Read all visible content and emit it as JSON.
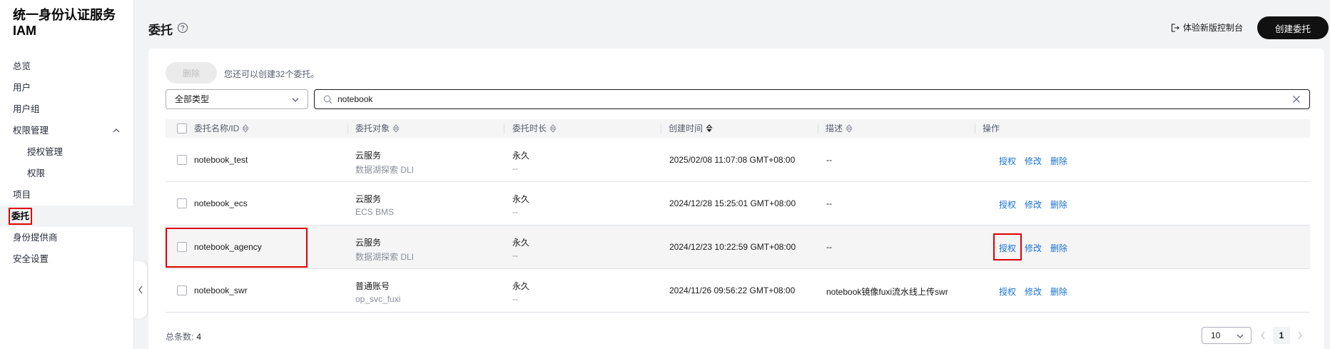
{
  "app": {
    "title": "统一身份认证服务 IAM"
  },
  "sidebar": {
    "items": [
      {
        "label": "总览"
      },
      {
        "label": "用户"
      },
      {
        "label": "用户组"
      },
      {
        "label": "权限管理"
      },
      {
        "label": "授权管理"
      },
      {
        "label": "权限"
      },
      {
        "label": "项目"
      },
      {
        "label": "委托"
      },
      {
        "label": "身份提供商"
      },
      {
        "label": "安全设置"
      }
    ]
  },
  "header": {
    "title": "委托",
    "console_link": "体验新版控制台",
    "create_button": "创建委托"
  },
  "toolbar": {
    "delete_button": "删除",
    "quota_text": "您还可以创建32个委托。",
    "type_filter": "全部类型",
    "search_value": "notebook"
  },
  "table": {
    "columns": [
      "委托名称/ID",
      "委托对象",
      "委托时长",
      "创建时间",
      "描述",
      "操作"
    ],
    "rows": [
      {
        "name": "notebook_test",
        "target": "云服务",
        "target_sub": "数据湖探索 DLI",
        "duration": "永久",
        "duration_sub": "--",
        "created": "2025/02/08 11:07:08 GMT+08:00",
        "desc": "--"
      },
      {
        "name": "notebook_ecs",
        "target": "云服务",
        "target_sub": "ECS BMS",
        "duration": "永久",
        "duration_sub": "--",
        "created": "2024/12/28 15:25:01 GMT+08:00",
        "desc": "--"
      },
      {
        "name": "notebook_agency",
        "target": "云服务",
        "target_sub": "数据湖探索 DLI",
        "duration": "永久",
        "duration_sub": "--",
        "created": "2024/12/23 10:22:59 GMT+08:00",
        "desc": "--"
      },
      {
        "name": "notebook_swr",
        "target": "普通账号",
        "target_sub": "op_svc_fuxi",
        "duration": "永久",
        "duration_sub": "--",
        "created": "2024/11/26 09:56:22 GMT+08:00",
        "desc": "notebook镜像fuxi流水线上传swr"
      }
    ],
    "actions": {
      "authorize": "授权",
      "modify": "修改",
      "delete": "删除"
    }
  },
  "footer": {
    "total_label": "总条数:",
    "total_count": "4",
    "page_size": "10",
    "current_page": "1"
  },
  "colors": {
    "link": "#1972d1",
    "highlight": "#e00000",
    "primary_button": "#111111"
  }
}
